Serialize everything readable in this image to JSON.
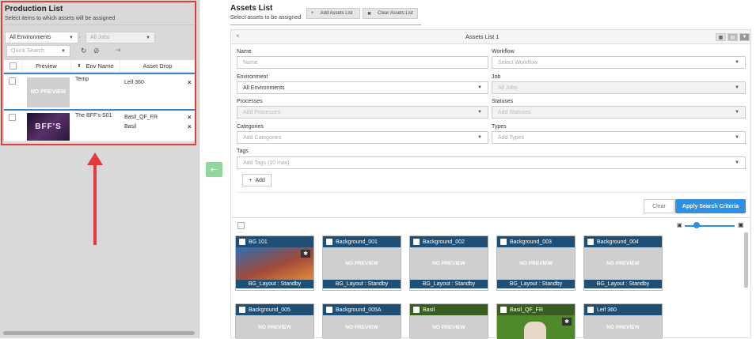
{
  "production": {
    "title": "Production List",
    "subtitle": "Select items to which assets will be assigned",
    "env_select": "All Environments",
    "jobs_select": "All Jobs",
    "quick_search": "Quick Search",
    "columns": {
      "preview": "Preview",
      "env_name": "Env Name",
      "asset_drop": "Asset Drop"
    },
    "rows": [
      {
        "preview": "NO PREVIEW",
        "env_name": "Temp",
        "assets": [
          "Leif 360"
        ]
      },
      {
        "thumb_text": "BFF'S",
        "env_name": "The BFF's S01",
        "assets": [
          "Basil_QF_FR",
          "Basil"
        ]
      }
    ]
  },
  "assets": {
    "title": "Assets List",
    "subtitle": "Select assets to be assigned",
    "add_btn": "Add Assets List",
    "clear_btn": "Clear Assets List",
    "panel_title": "Assets List 1",
    "fields": {
      "name_label": "Name",
      "name_ph": "Name",
      "workflow_label": "Workflow",
      "workflow_ph": "Select Workflow",
      "environment_label": "Environment",
      "environment_val": "All Environments",
      "job_label": "Job",
      "job_val": "All Jobs",
      "processes_label": "Processes",
      "processes_ph": "Add Processes",
      "statuses_label": "Statuses",
      "statuses_ph": "Add Statuses",
      "categories_label": "Categories",
      "categories_ph": "Add Categories",
      "types_label": "Types",
      "types_ph": "Add Types",
      "tags_label": "Tags",
      "tags_ph": "Add Tags (10 max)"
    },
    "add_label": "Add",
    "clear_label": "Clear",
    "apply_label": "Apply Search Criteria",
    "cards_row1": [
      {
        "name": "BG 101",
        "footer": "BG_Layout : Standby",
        "has_image": true
      },
      {
        "name": "Background_001",
        "preview": "NO PREVIEW",
        "footer": "BG_Layout : Standby"
      },
      {
        "name": "Background_002",
        "preview": "NO PREVIEW",
        "footer": "BG_Layout : Standby"
      },
      {
        "name": "Background_003",
        "preview": "NO PREVIEW",
        "footer": "BG_Layout : Standby"
      },
      {
        "name": "Background_004",
        "preview": "NO PREVIEW",
        "footer": "BG_Layout : Standby"
      }
    ],
    "cards_row2": [
      {
        "name": "Background_005",
        "preview": "NO PREVIEW"
      },
      {
        "name": "Background_005A",
        "preview": "NO PREVIEW"
      },
      {
        "name": "Basil",
        "preview": "NO PREVIEW"
      },
      {
        "name": "Basil_QF_FR",
        "has_image": true
      },
      {
        "name": "Leif 360",
        "preview": "NO PREVIEW"
      }
    ]
  },
  "colors": {
    "highlight": "#e23c3c",
    "card_blue": "#1f4f74",
    "card_green": "#3a5e21",
    "apply": "#2f8fe0"
  }
}
